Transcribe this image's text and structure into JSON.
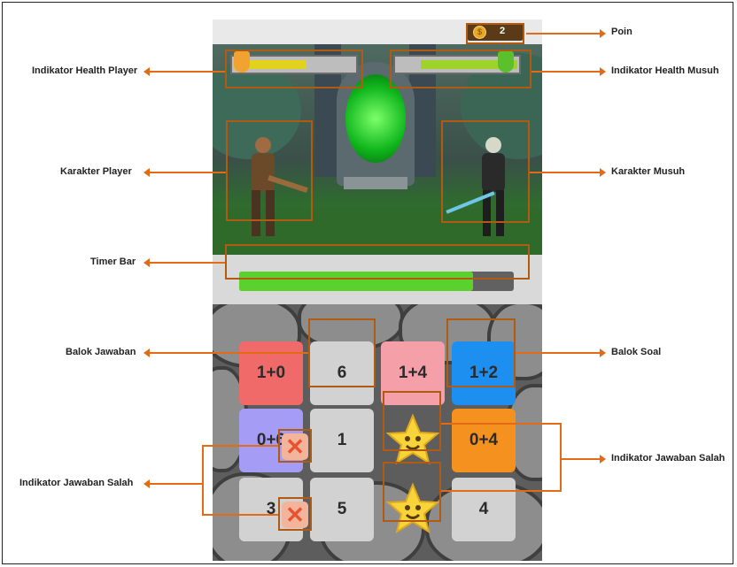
{
  "labels": {
    "poin": "Poin",
    "health_player": "Indikator Health Player",
    "health_musuh": "Indikator Health Musuh",
    "karakter_player": "Karakter Player",
    "karakter_musuh": "Karakter Musuh",
    "timer_bar": "Timer Bar",
    "balok_jawaban": "Balok Jawaban",
    "balok_soal": "Balok Soal",
    "salah_left": "Indikator Jawaban Salah",
    "salah_right": "Indikator Jawaban Salah"
  },
  "hud": {
    "coin_icon": "coin-icon",
    "points": "2",
    "player_health": 0.6,
    "enemy_health": 0.8
  },
  "timer": {
    "fill": 0.85
  },
  "tiles": [
    {
      "text": "1+0",
      "color": "#f06a6a"
    },
    {
      "text": "6",
      "color": "#d2d2d2"
    },
    {
      "text": "1+4",
      "color": "#f5a0a8"
    },
    {
      "text": "1+2",
      "color": "#1d8ff0"
    },
    {
      "text": "0+6",
      "color": "#a59cf5"
    },
    {
      "text": "1",
      "color": "#d2d2d2"
    },
    {
      "text": "",
      "color": "star"
    },
    {
      "text": "0+4",
      "color": "#f5911e"
    },
    {
      "text": "3",
      "color": "#d2d2d2"
    },
    {
      "text": "5",
      "color": "#d2d2d2"
    },
    {
      "text": "",
      "color": "star"
    },
    {
      "text": "4",
      "color": "#d2d2d2"
    }
  ],
  "colors": {
    "accent": "#e36b16",
    "highlight": "#b05a12"
  }
}
